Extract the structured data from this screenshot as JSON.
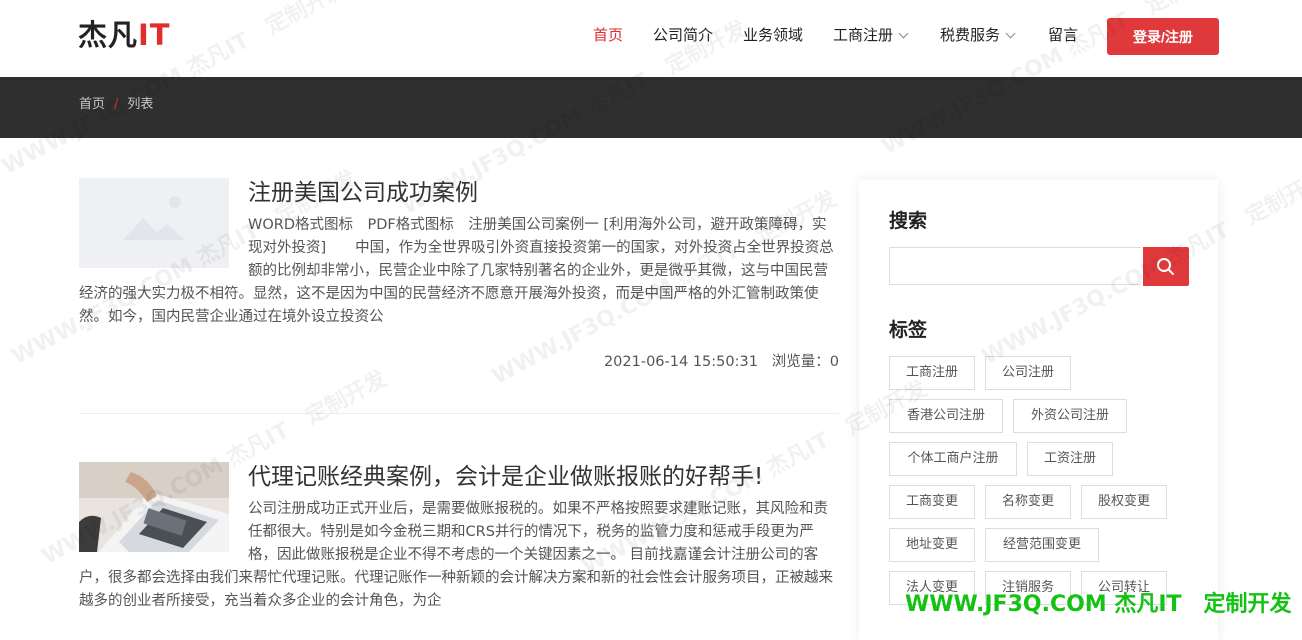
{
  "logo": {
    "main": "杰凡",
    "accent": "IT"
  },
  "nav": {
    "items": [
      {
        "label": "首页",
        "active": true
      },
      {
        "label": "公司简介"
      },
      {
        "label": "业务领域"
      },
      {
        "label": "工商注册",
        "dropdown": true
      },
      {
        "label": "税费服务",
        "dropdown": true
      },
      {
        "label": "留言"
      }
    ],
    "login_label": "登录/注册"
  },
  "breadcrumb": {
    "home": "首页",
    "separator": "/",
    "current": "列表"
  },
  "articles": [
    {
      "title": "注册美国公司成功案例",
      "summary": "WORD格式图标　PDF格式图标　注册美国公司案例一 [利用海外公司，避开政策障碍，实现对外投资]　　中国，作为全世界吸引外资直接投资第一的国家，对外投资占全世界投资总额的比例却非常小，民营企业中除了几家特别著名的企业外，更是微乎其微，这与中国民营经济的强大实力极不相符。显然，这不是因为中国的民营经济不愿意开展海外投资，而是中国严格的外汇管制政策使然。如今，国内民营企业通过在境外设立投资公",
      "date": "2021-06-14 15:50:31",
      "views_label": "浏览量：",
      "views": "0"
    },
    {
      "title": "代理记账经典案例，会计是企业做账报账的好帮手!",
      "summary": "公司注册成功正式开业后，是需要做账报税的。如果不严格按照要求建账记账，其风险和责任都很大。特别是如今金税三期和CRS并行的情况下，税务的监管力度和惩戒手段更为严格，因此做账报税是企业不得不考虑的一个关键因素之一。 目前找嘉谨会计注册公司的客户，很多都会选择由我们来帮忙代理记账。代理记账作一种新颖的会计解决方案和新的社会性会计服务项目，正被越来越多的创业者所接受，充当着众多企业的会计角色，为企"
    }
  ],
  "sidebar": {
    "search_title": "搜索",
    "tags_title": "标签",
    "tags": [
      "工商注册",
      "公司注册",
      "香港公司注册",
      "外资公司注册",
      "个体工商户注册",
      "工资注册",
      "工商变更",
      "名称变更",
      "股权变更",
      "地址变更",
      "经营范围变更",
      "法人变更",
      "注销服务",
      "公司转让"
    ]
  },
  "watermark": {
    "text": "WWW.JF3Q.COM 杰凡IT　定制开发",
    "bottom": "WWW.JF3Q.COM 杰凡IT　定制开发"
  },
  "colors": {
    "accent": "#e02e2e",
    "button": "#e0393c",
    "dark_bar": "#2f2f2f",
    "watermark_green": "#14c214"
  }
}
